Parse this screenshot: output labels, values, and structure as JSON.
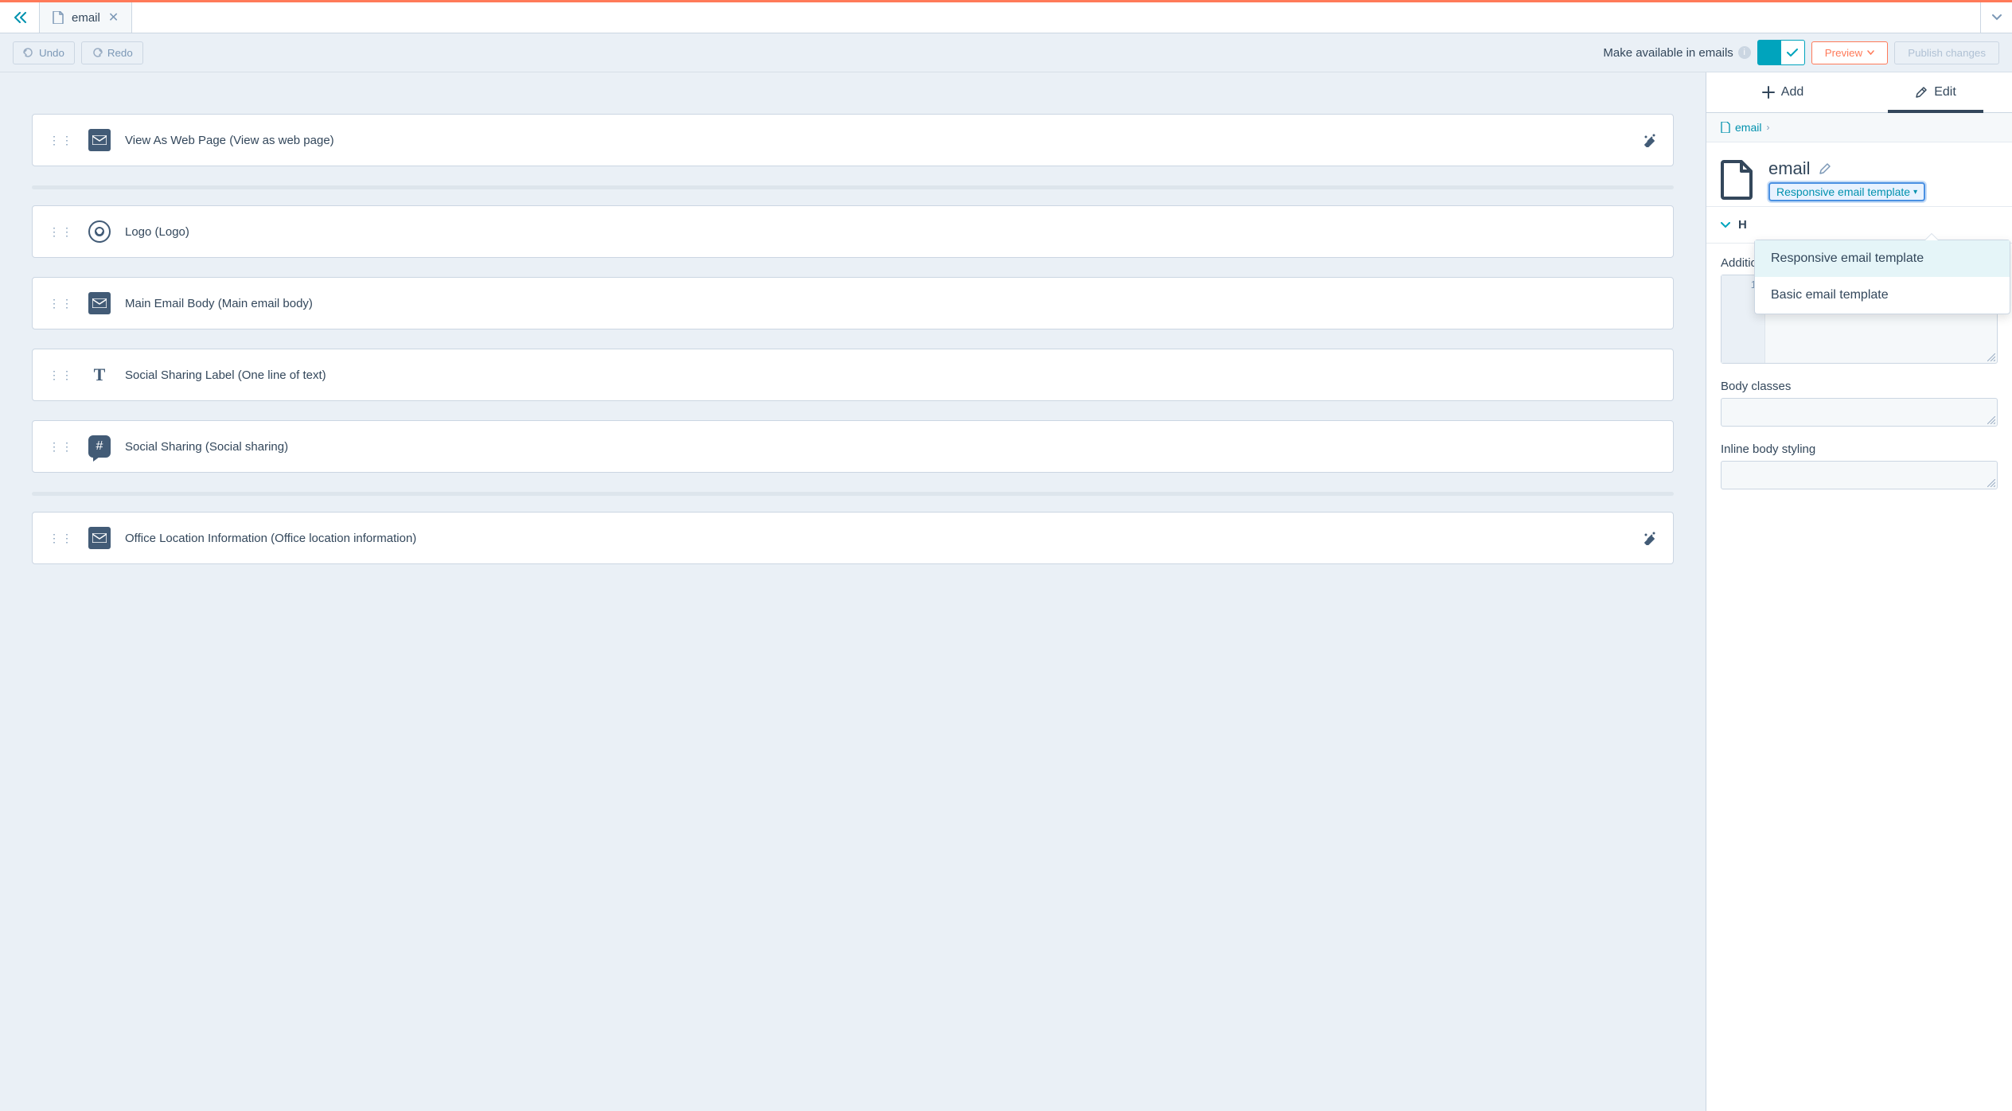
{
  "tab": {
    "title": "email"
  },
  "actions": {
    "undo": "Undo",
    "redo": "Redo",
    "available_label": "Make available in emails",
    "preview": "Preview",
    "publish": "Publish changes"
  },
  "modules": [
    {
      "icon": "mail",
      "label": "View As Web Page (View as web page)",
      "action_icon": true
    },
    {
      "spacer": true
    },
    {
      "icon": "logo",
      "label": "Logo (Logo)",
      "action_icon": false
    },
    {
      "icon": "mail",
      "label": "Main Email Body (Main email body)",
      "action_icon": false
    },
    {
      "icon": "text",
      "label": "Social Sharing Label (One line of text)",
      "action_icon": false
    },
    {
      "icon": "hash",
      "label": "Social Sharing (Social sharing)",
      "action_icon": false
    },
    {
      "spacer": true
    },
    {
      "icon": "mail",
      "label": "Office Location Information (Office location information)",
      "action_icon": true
    }
  ],
  "sidebar": {
    "tabs": {
      "add": "Add",
      "edit": "Edit",
      "active": "edit"
    },
    "breadcrumb": {
      "name": "email"
    },
    "asset": {
      "title": "email",
      "template_type": "Responsive email template",
      "template_options": [
        "Responsive email template",
        "Basic email template"
      ]
    },
    "section": {
      "title": "H",
      "head_label": "Additional <head> markup",
      "expand": "Expand",
      "gutter_line": "1",
      "body_classes_label": "Body classes",
      "inline_body_label": "Inline body styling"
    }
  }
}
